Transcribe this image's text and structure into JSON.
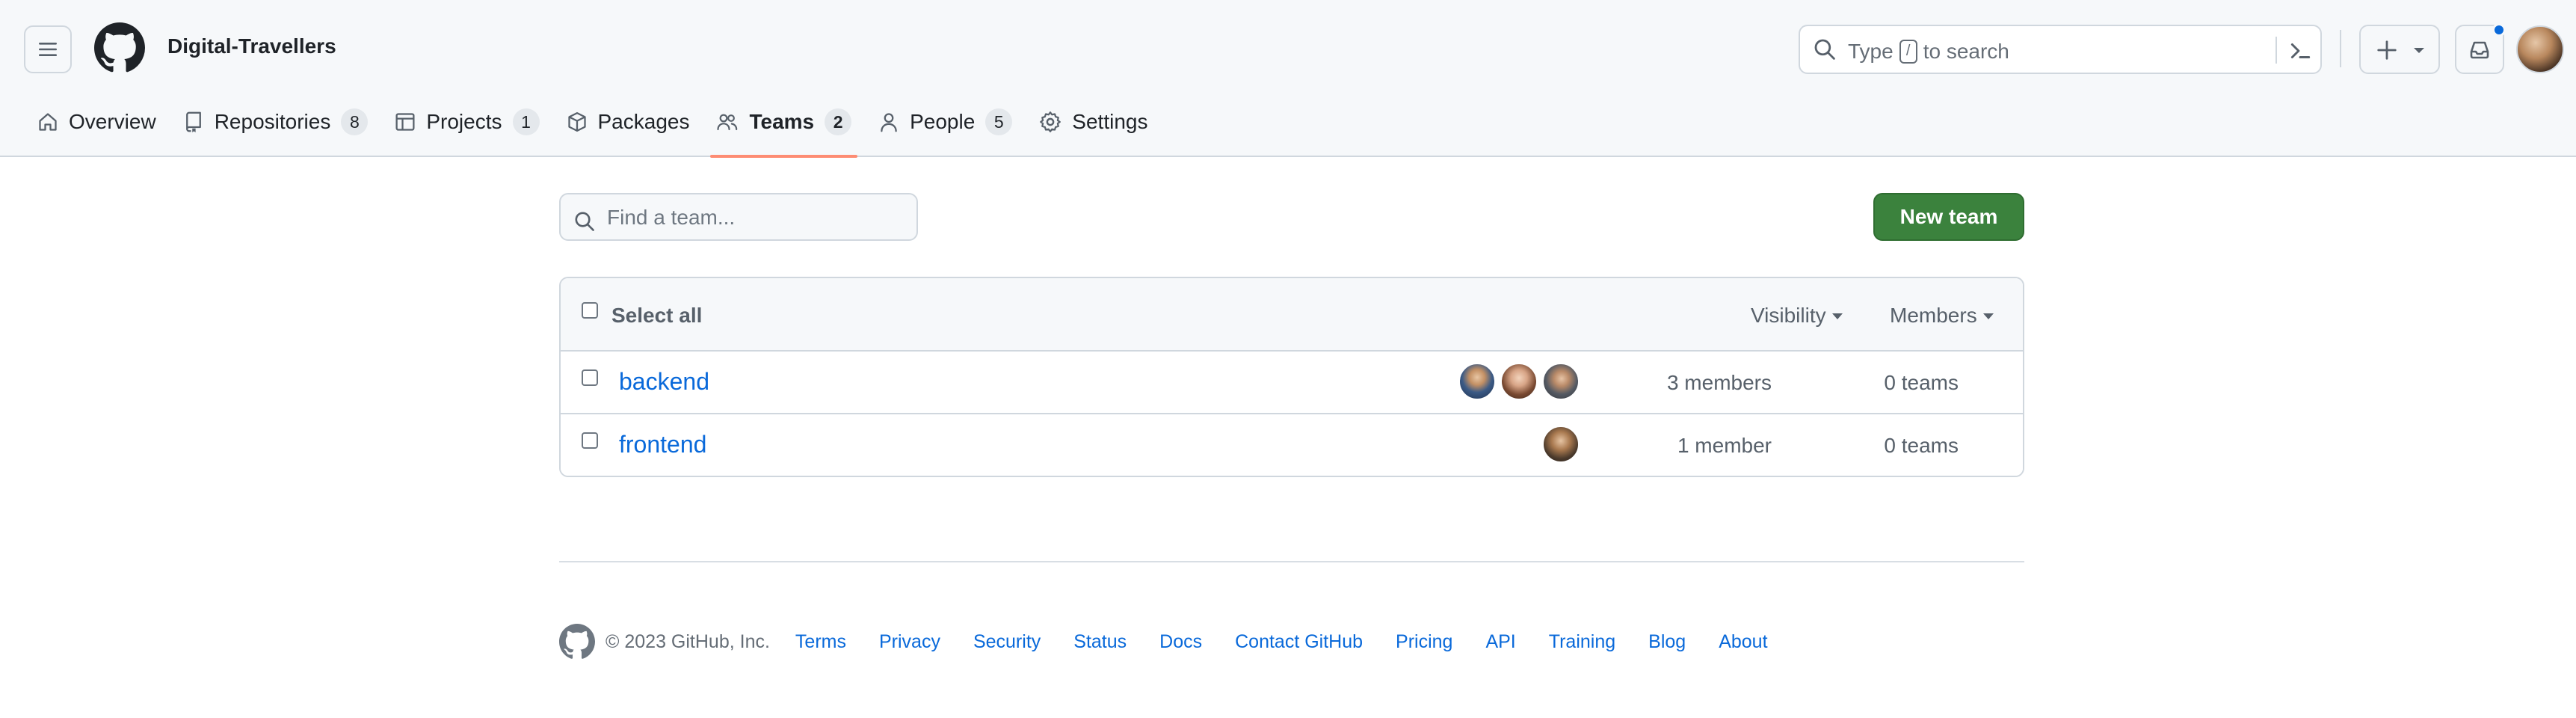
{
  "header": {
    "org_name": "Digital-Travellers",
    "search": {
      "prefix": "Type",
      "shortcut_key": "/",
      "suffix": "to search"
    },
    "colors": {
      "accent_underline": "#fd8c73",
      "notification_dot": "#0969da"
    }
  },
  "tabs": [
    {
      "label": "Overview",
      "icon": "home-icon"
    },
    {
      "label": "Repositories",
      "icon": "repo-icon",
      "count": "8"
    },
    {
      "label": "Projects",
      "icon": "table-icon",
      "count": "1"
    },
    {
      "label": "Packages",
      "icon": "package-icon"
    },
    {
      "label": "Teams",
      "icon": "people-icon",
      "count": "2",
      "active": true
    },
    {
      "label": "People",
      "icon": "person-icon",
      "count": "5"
    },
    {
      "label": "Settings",
      "icon": "gear-icon"
    }
  ],
  "main": {
    "find_placeholder": "Find a team...",
    "new_team_label": "New team",
    "new_team_color": "#3b823d",
    "table": {
      "select_all_label": "Select all",
      "filters": [
        "Visibility",
        "Members"
      ],
      "rows": [
        {
          "name": "backend",
          "members": "3 members",
          "teams": "0 teams"
        },
        {
          "name": "frontend",
          "members": "1 member",
          "teams": "0 teams"
        }
      ]
    }
  },
  "footer": {
    "copyright": "© 2023 GitHub, Inc.",
    "links": [
      "Terms",
      "Privacy",
      "Security",
      "Status",
      "Docs",
      "Contact GitHub",
      "Pricing",
      "API",
      "Training",
      "Blog",
      "About"
    ]
  }
}
